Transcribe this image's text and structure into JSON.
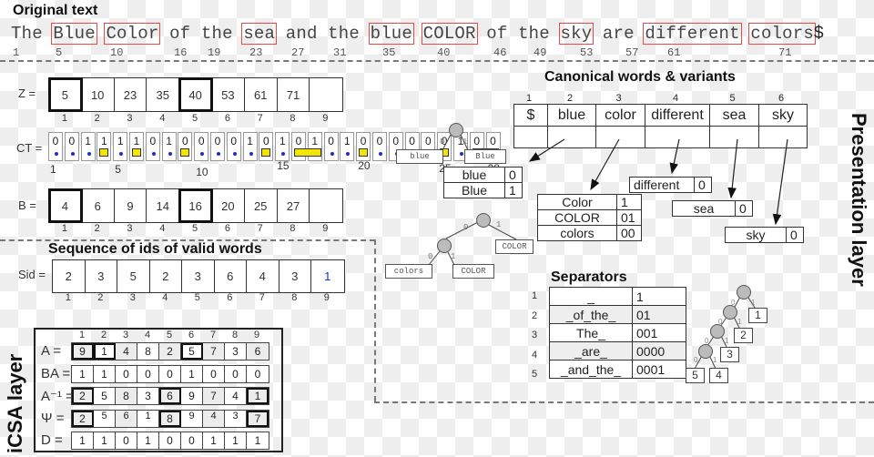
{
  "original_text": {
    "title": "Original text",
    "tokens": [
      {
        "text": "The",
        "boxed": false
      },
      {
        "text": "Blue",
        "boxed": true
      },
      {
        "text": "Color",
        "boxed": true
      },
      {
        "text": "of",
        "boxed": false
      },
      {
        "text": "the",
        "boxed": false
      },
      {
        "text": "sea",
        "boxed": true
      },
      {
        "text": "and",
        "boxed": false
      },
      {
        "text": "the",
        "boxed": false
      },
      {
        "text": "blue",
        "boxed": true
      },
      {
        "text": "COLOR",
        "boxed": true
      },
      {
        "text": "of",
        "boxed": false
      },
      {
        "text": "the",
        "boxed": false
      },
      {
        "text": "sky",
        "boxed": true
      },
      {
        "text": "are",
        "boxed": false
      },
      {
        "text": "different",
        "boxed": true
      },
      {
        "text": "colors",
        "boxed": true
      }
    ],
    "end_marker": "$",
    "positions": [
      "1",
      "5",
      "10",
      "16",
      "19",
      "23",
      "27",
      "31",
      "35",
      "40",
      "46",
      "49",
      "53",
      "57",
      "61",
      "71"
    ]
  },
  "z_array": {
    "label": "Z  =",
    "values": [
      "5",
      "10",
      "23",
      "35",
      "40",
      "53",
      "61",
      "71",
      ""
    ],
    "highlighted": [
      1,
      5
    ],
    "indices": [
      "1",
      "2",
      "3",
      "4",
      "5",
      "6",
      "7",
      "8",
      "9"
    ]
  },
  "ct_array": {
    "label": "CT =",
    "bits": [
      "0",
      "0",
      "1",
      "1",
      "1",
      "1",
      "0",
      "1",
      "0",
      "0",
      "0",
      "0",
      "1",
      "0",
      "1",
      "0",
      "1",
      "0",
      "1",
      "0",
      "0",
      "0",
      "0",
      "0",
      "0",
      "1",
      "0",
      "0"
    ],
    "marked_positions": [
      4,
      6,
      9,
      14,
      16,
      17,
      20,
      25,
      27,
      28
    ],
    "tick_labels": [
      "1",
      "5",
      "10",
      "15",
      "20",
      "25",
      "28"
    ]
  },
  "b_array": {
    "label": "B  =",
    "values": [
      "4",
      "6",
      "9",
      "14",
      "16",
      "20",
      "25",
      "27",
      ""
    ],
    "highlighted": [
      1,
      5
    ],
    "indices": [
      "1",
      "2",
      "3",
      "4",
      "5",
      "6",
      "7",
      "8",
      "9"
    ]
  },
  "sid": {
    "title": "Sequence of ids of valid words",
    "label": "Sid =",
    "values": [
      "2",
      "3",
      "5",
      "2",
      "3",
      "6",
      "4",
      "3",
      "1"
    ],
    "last_value_color": "#1a2bd8",
    "indices": [
      "1",
      "2",
      "3",
      "4",
      "5",
      "6",
      "7",
      "8",
      "9"
    ]
  },
  "icsa": {
    "layer_label": "iCSA layer",
    "column_indices": [
      "1",
      "2",
      "3",
      "4",
      "5",
      "6",
      "7",
      "8",
      "9"
    ],
    "rows": [
      {
        "label": "A  =",
        "values": [
          "9",
          "1",
          "4",
          "8",
          "2",
          "5",
          "7",
          "3",
          "6"
        ],
        "bold": [
          1,
          2,
          6
        ]
      },
      {
        "label": "BA =",
        "values": [
          "1",
          "1",
          "0",
          "0",
          "0",
          "1",
          "0",
          "0",
          "0"
        ],
        "bold": []
      },
      {
        "label": "A⁻¹ =",
        "values": [
          "2",
          "5",
          "8",
          "3",
          "6",
          "9",
          "7",
          "4",
          "1"
        ],
        "bold": [
          1,
          5,
          9
        ]
      },
      {
        "label": "Ψ  =",
        "values": [
          "2",
          "5",
          "6",
          "1",
          "8",
          "9",
          "4",
          "3",
          "7"
        ],
        "bold": [
          1,
          5,
          9
        ]
      },
      {
        "label": "D  =",
        "values": [
          "1",
          "1",
          "0",
          "1",
          "0",
          "0",
          "1",
          "1",
          "1"
        ],
        "bold": []
      }
    ]
  },
  "presentation": {
    "layer_label": "Presentation layer",
    "canonical_title": "Canonical words & variants",
    "canonical": {
      "indices": [
        "1",
        "2",
        "3",
        "4",
        "5",
        "6"
      ],
      "words": [
        "$",
        "blue",
        "color",
        "different",
        "sea",
        "sky"
      ]
    },
    "variants": {
      "blue": [
        {
          "word": "blue",
          "code": "0"
        },
        {
          "word": "Blue",
          "code": "1"
        }
      ],
      "color": [
        {
          "word": "Color",
          "code": "1"
        },
        {
          "word": "COLOR",
          "code": "01"
        },
        {
          "word": "colors",
          "code": "00"
        }
      ],
      "different": [
        {
          "word": "different",
          "code": "0"
        }
      ],
      "sea": [
        {
          "word": "sea",
          "code": "0"
        }
      ],
      "sky": [
        {
          "word": "sky",
          "code": "0"
        }
      ]
    },
    "trees": {
      "blue_leaves": [
        "blue",
        "Blue"
      ],
      "color_leaves": [
        "colors",
        "COLOR",
        "COLOR"
      ],
      "edge_labels": [
        "0",
        "1"
      ]
    },
    "separators": {
      "title": "Separators",
      "rows": [
        {
          "n": "1",
          "sep": "_",
          "code": "1"
        },
        {
          "n": "2",
          "sep": "_of_the_",
          "code": "01"
        },
        {
          "n": "3",
          "sep": "The_",
          "code": "001"
        },
        {
          "n": "4",
          "sep": "_are_",
          "code": "0000"
        },
        {
          "n": "5",
          "sep": "_and_the_",
          "code": "0001"
        }
      ],
      "tree_leaves": [
        "1",
        "2",
        "3",
        "4",
        "5"
      ]
    }
  }
}
